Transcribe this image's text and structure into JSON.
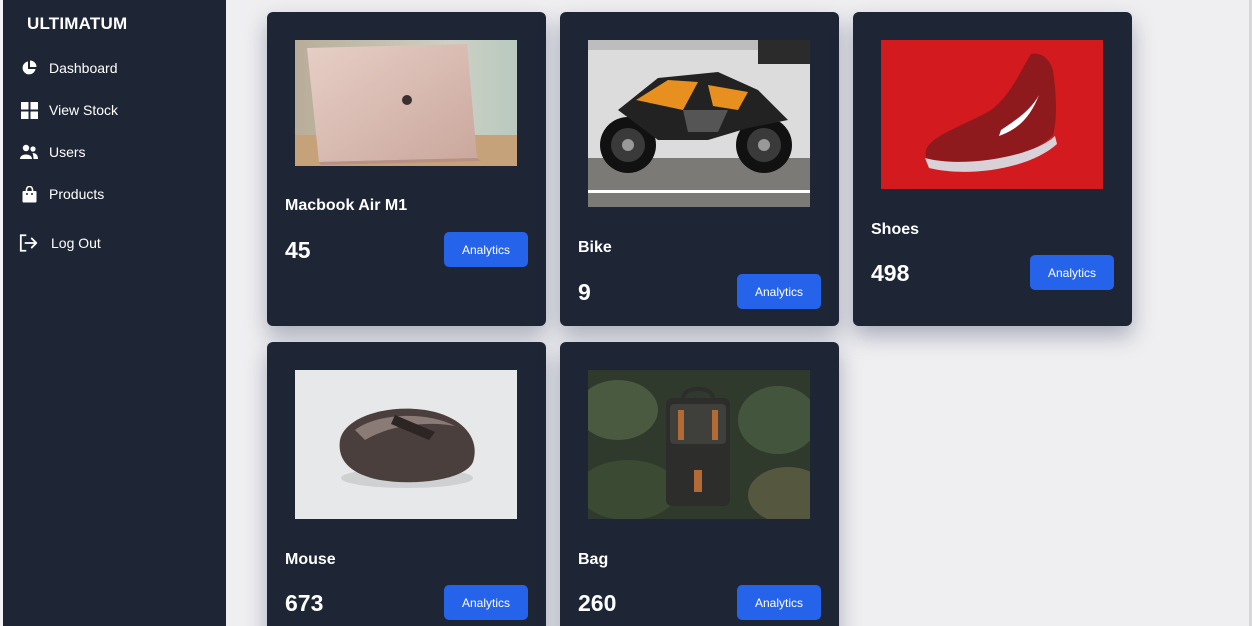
{
  "sidebar": {
    "brand": "ULTIMATUM",
    "items": [
      {
        "label": "Dashboard",
        "icon": "pie-chart-icon"
      },
      {
        "label": "View Stock",
        "icon": "grid-icon"
      },
      {
        "label": "Users",
        "icon": "users-icon"
      },
      {
        "label": "Products",
        "icon": "shopping-bag-icon"
      },
      {
        "label": "Log Out",
        "icon": "logout-icon"
      }
    ]
  },
  "products": [
    {
      "name": "Macbook Air M1",
      "count": "45",
      "button": "Analytics",
      "image": "laptop-photo"
    },
    {
      "name": "Bike",
      "count": "9",
      "button": "Analytics",
      "image": "motorcycle-photo"
    },
    {
      "name": "Shoes",
      "count": "498",
      "button": "Analytics",
      "image": "red-sneaker-photo"
    },
    {
      "name": "Mouse",
      "count": "673",
      "button": "Analytics",
      "image": "computer-mouse-photo"
    },
    {
      "name": "Bag",
      "count": "260",
      "button": "Analytics",
      "image": "backpack-photo"
    }
  ],
  "colors": {
    "sidebar_bg": "#1e2535",
    "card_bg": "#1e2535",
    "accent": "#2563eb",
    "page_bg": "#efeff1"
  }
}
